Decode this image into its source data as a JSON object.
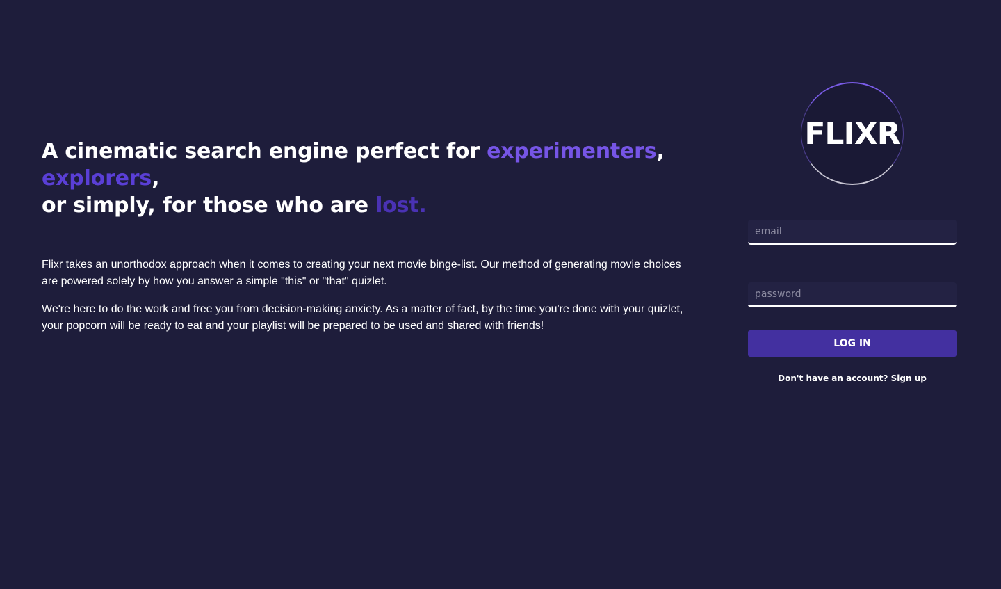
{
  "hero": {
    "headline": {
      "part1": "A cinematic search engine perfect for ",
      "experimenters": "experimenters",
      "comma1": ", ",
      "explorers": "explorers",
      "part2": ",",
      "part3": " or simply, for those who are ",
      "lost": "lost."
    },
    "paragraphs": [
      "Flixr takes an unorthodox approach when it comes to creating your next movie binge-list. Our method of generating movie choices are powered solely by how you answer a simple \"this\" or \"that\" quizlet.",
      "We're here to do the work and free you from decision-making anxiety. As a matter of fact, by the time you're done with your quizlet, your popcorn will be ready to eat and your playlist will be prepared to be used and shared with friends!"
    ]
  },
  "auth": {
    "logo_text": "FLIXR",
    "email": {
      "placeholder": "email",
      "value": ""
    },
    "password": {
      "placeholder": "password",
      "value": ""
    },
    "login_label": "LOG IN",
    "signup_prompt": "Don't have an account?",
    "signup_link": "Sign up"
  },
  "colors": {
    "background": "#1e1d3b",
    "accent_experimenters": "#7655e6",
    "accent_explorers": "#5a3fd6",
    "accent_lost": "#4a32b4",
    "button": "#4330a0"
  }
}
